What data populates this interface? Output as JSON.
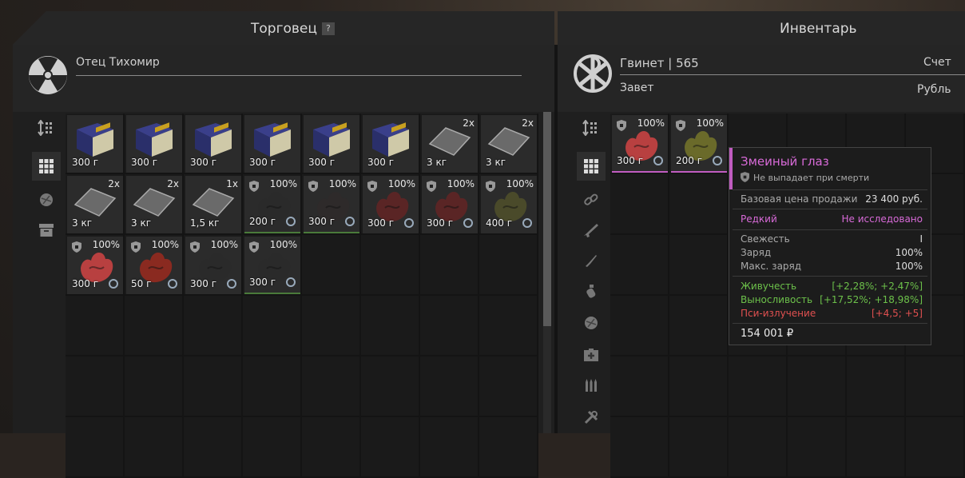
{
  "trader_header": {
    "title": "Торговец",
    "help": "?"
  },
  "inventory_header": {
    "title": "Инвентарь"
  },
  "trader": {
    "name": "Отец Тихомир"
  },
  "player": {
    "name": "Гвинет | 565",
    "faction": "Завет",
    "account_label": "Счет",
    "currency_label": "Рубль"
  },
  "trader_items": [
    {
      "kind": "book",
      "count": "",
      "weight": "300 г",
      "frame": ""
    },
    {
      "kind": "book",
      "count": "",
      "weight": "300 г",
      "frame": ""
    },
    {
      "kind": "book",
      "count": "",
      "weight": "300 г",
      "frame": ""
    },
    {
      "kind": "book",
      "count": "",
      "weight": "300 г",
      "frame": ""
    },
    {
      "kind": "book",
      "count": "",
      "weight": "300 г",
      "frame": ""
    },
    {
      "kind": "book",
      "count": "",
      "weight": "300 г",
      "frame": ""
    },
    {
      "kind": "plate",
      "count": "2x",
      "weight": "3 кг",
      "frame": ""
    },
    {
      "kind": "plate",
      "count": "2x",
      "weight": "3 кг",
      "frame": ""
    },
    {
      "kind": "plate",
      "count": "2x",
      "weight": "3 кг",
      "frame": ""
    },
    {
      "kind": "plate",
      "count": "2x",
      "weight": "3 кг",
      "frame": ""
    },
    {
      "kind": "plate",
      "count": "1x",
      "weight": "1,5 кг",
      "frame": ""
    },
    {
      "kind": "artifact",
      "count": "100%",
      "weight": "200 г",
      "frame": "green",
      "color": "#2a2a2a"
    },
    {
      "kind": "artifact",
      "count": "100%",
      "weight": "300 г",
      "frame": "green",
      "color": "#2e2a2a"
    },
    {
      "kind": "artifact",
      "count": "100%",
      "weight": "300 г",
      "frame": "",
      "color": "#5a2525"
    },
    {
      "kind": "artifact",
      "count": "100%",
      "weight": "300 г",
      "frame": "",
      "color": "#5a2525"
    },
    {
      "kind": "artifact",
      "count": "100%",
      "weight": "400 г",
      "frame": "",
      "color": "#4a4a2a"
    },
    {
      "kind": "artifact",
      "count": "100%",
      "weight": "300 г",
      "frame": "",
      "color": "#b84040"
    },
    {
      "kind": "artifact",
      "count": "100%",
      "weight": "50 г",
      "frame": "",
      "color": "#8a2a20"
    },
    {
      "kind": "artifact",
      "count": "100%",
      "weight": "300 г",
      "frame": "",
      "color": "#2a2a2a"
    },
    {
      "kind": "artifact",
      "count": "100%",
      "weight": "300 г",
      "frame": "green",
      "color": "#2a2a2a"
    }
  ],
  "inventory_items": [
    {
      "kind": "artifact",
      "count": "100%",
      "weight": "300 г",
      "frame": "pink",
      "color": "#b84040"
    },
    {
      "kind": "artifact",
      "count": "100%",
      "weight": "200 г",
      "frame": "pink",
      "color": "#6a6a2a"
    }
  ],
  "tooltip": {
    "title": "Змеиный глаз",
    "subtitle": "Не выпадает при смерти",
    "base_price_label": "Базовая цена продажи",
    "base_price": "23 400 руб.",
    "rarity": "Редкий",
    "research": "Не исследовано",
    "freshness_label": "Свежесть",
    "freshness": "I",
    "charge_label": "Заряд",
    "charge": "100%",
    "max_charge_label": "Макс. заряд",
    "max_charge": "100%",
    "stats": [
      {
        "name": "Живучесть",
        "value": "[+2,28%; +2,47%]",
        "color": "#6cc04a"
      },
      {
        "name": "Выносливость",
        "value": "[+17,52%; +18,98%]",
        "color": "#6cc04a"
      },
      {
        "name": "Пси-излучение",
        "value": "[+4,5; +5]",
        "color": "#e05050"
      }
    ],
    "price": "154 001 ₽"
  },
  "colors": {
    "rare": "#d86ad8",
    "positive": "#6cc04a",
    "negative": "#e05050"
  },
  "icons": [
    "radiation-icon",
    "chi-rho-icon",
    "sort-icon",
    "grid-icon",
    "artifact-filter-icon",
    "archive-icon",
    "link-icon",
    "rifle-icon",
    "knife-icon",
    "grenade-icon",
    "medkit-icon",
    "ammo-icon",
    "tools-icon",
    "shield-icon",
    "clock-icon"
  ]
}
